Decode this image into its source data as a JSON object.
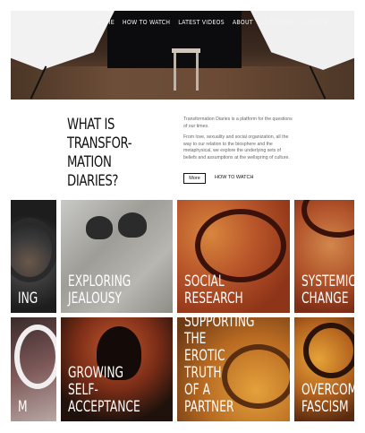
{
  "nav": {
    "items": [
      "HOME",
      "HOW TO WATCH",
      "LATEST VIDEOS",
      "ABOUT",
      "SUBSCRIBE",
      "DONATE"
    ]
  },
  "intro": {
    "title": "WHAT IS\nTRANSFOR-\nMATION\nDIARIES?",
    "paragraph1": "Transformation Diaries is a platform for the questions of our times.",
    "paragraph2": "From love, sexuality and social organization, all the way to our relation to the biosphere and the metaphysical, we explore the underlying sets of beliefs and assumptions at the wellspring of culture.",
    "more_label": "More",
    "how_label": "HOW TO WATCH"
  },
  "tiles": [
    {
      "label": "ING"
    },
    {
      "label": "EXPLORING\nJEALOUSY"
    },
    {
      "label": "SOCIAL\nRESEARCH"
    },
    {
      "label": "SYSTEMIC\nCHANGE"
    },
    {
      "label": "M"
    },
    {
      "label": "GROWING\nSELF-\nACCEPTANCE"
    },
    {
      "label": "SUPPORTING\nTHE\nEROTIC\nTRUTH\nOF A\nPARTNER"
    },
    {
      "label": "OVERCOM\nFASCISM"
    }
  ]
}
